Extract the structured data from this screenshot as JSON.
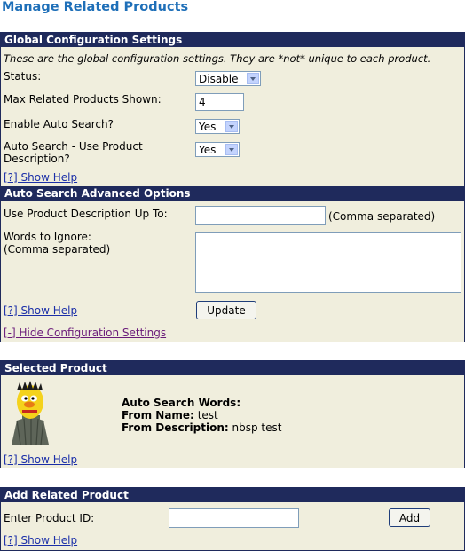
{
  "page_title": "Manage Related Products",
  "global_config": {
    "header": "Global Configuration Settings",
    "note": "These are the global configuration settings. They are *not* unique to each product.",
    "status_label": "Status:",
    "status_value": "Disable",
    "max_label": "Max Related Products Shown:",
    "max_value": "4",
    "auto_search_label": "Enable Auto Search?",
    "auto_search_value": "Yes",
    "use_desc_label_1": "Auto Search - Use Product",
    "use_desc_label_2": "Description?",
    "use_desc_value": "Yes",
    "help": "[?] Show Help"
  },
  "advanced": {
    "header": "Auto Search Advanced Options",
    "desc_upto_label": "Use Product Description Up To:",
    "desc_upto_value": "",
    "comma_note": "(Comma separated)",
    "ignore_label_1": "Words to Ignore:",
    "ignore_label_2": "(Comma separated)",
    "ignore_value": "",
    "help": "[?] Show Help",
    "update_button": "Update",
    "hide_link": "[-] Hide Configuration Settings"
  },
  "selected": {
    "header": "Selected Product",
    "auto_search_words": "Auto Search Words:",
    "from_name_label": "From Name:",
    "from_name_value": "test",
    "from_desc_label": "From Description:",
    "from_desc_value": "nbsp test",
    "help": "[?] Show Help"
  },
  "add_related": {
    "header": "Add Related Product",
    "product_id_label": "Enter Product ID:",
    "product_id_value": "",
    "add_button": "Add",
    "help": "[?] Show Help"
  }
}
